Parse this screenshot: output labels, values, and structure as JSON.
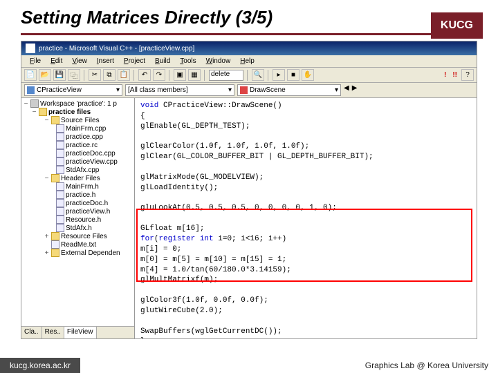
{
  "slide": {
    "title": "Setting Matrices Directly (3/5)",
    "badge": "KUCG"
  },
  "ide": {
    "windowTitle": "practice - Microsoft Visual C++ - [practiceView.cpp]",
    "menu": [
      "File",
      "Edit",
      "View",
      "Insert",
      "Project",
      "Build",
      "Tools",
      "Window",
      "Help"
    ],
    "findPlaceholder": "delete",
    "comboClass": "CPracticeView",
    "comboFilter": "[All class members]",
    "comboFunc": "DrawScene",
    "tree": {
      "workspace": "Workspace 'practice': 1 p",
      "project": "practice files",
      "folders": {
        "source": "Source Files",
        "header": "Header Files",
        "resource": "Resource Files",
        "readme": "ReadMe.txt",
        "external": "External Dependen"
      },
      "sourceFiles": [
        "MainFrm.cpp",
        "practice.cpp",
        "practice.rc",
        "practiceDoc.cpp",
        "practiceView.cpp",
        "StdAfx.cpp"
      ],
      "headerFiles": [
        "MainFrm.h",
        "practice.h",
        "practiceDoc.h",
        "practiceView.h",
        "Resource.h",
        "StdAfx.h"
      ],
      "tabs": [
        "Cla..",
        "Res..",
        "FileView"
      ]
    },
    "code": {
      "l1a": "void",
      "l1b": " CPracticeView::DrawScene()",
      "l2": "{",
      "l3": "    glEnable(GL_DEPTH_TEST);",
      "l4": "    glClearColor(1.0f, 1.0f, 1.0f, 1.0f);",
      "l5": "    glClear(GL_COLOR_BUFFER_BIT | GL_DEPTH_BUFFER_BIT);",
      "l6": "    glMatrixMode(GL_MODELVIEW);",
      "l7": "    glLoadIdentity();",
      "l8": "    gluLookAt(0.5, 0.5, 0.5, 0, 0, 0, 0, 1, 0);",
      "l9": "    GLfloat m[16];",
      "l10a": "    for",
      "l10b": "(",
      "l10c": "register int",
      "l10d": " i=0; i<16; i++)",
      "l11": "        m[i] = 0;",
      "l12": "    m[0] = m[5] = m[10] = m[15] = 1;",
      "l13": "    m[4] = 1.0/tan(60/180.0*3.14159);",
      "l14": "    glMultMatrixf(m);",
      "l15": "    glColor3f(1.0f, 0.0f, 0.0f);",
      "l16": "    glutWireCube(2.0);",
      "l17": "    SwapBuffers(wglGetCurrentDC());",
      "l18": "}"
    }
  },
  "footer": {
    "url": "kucg.korea.ac.kr",
    "credit": "Graphics Lab @ Korea University"
  }
}
